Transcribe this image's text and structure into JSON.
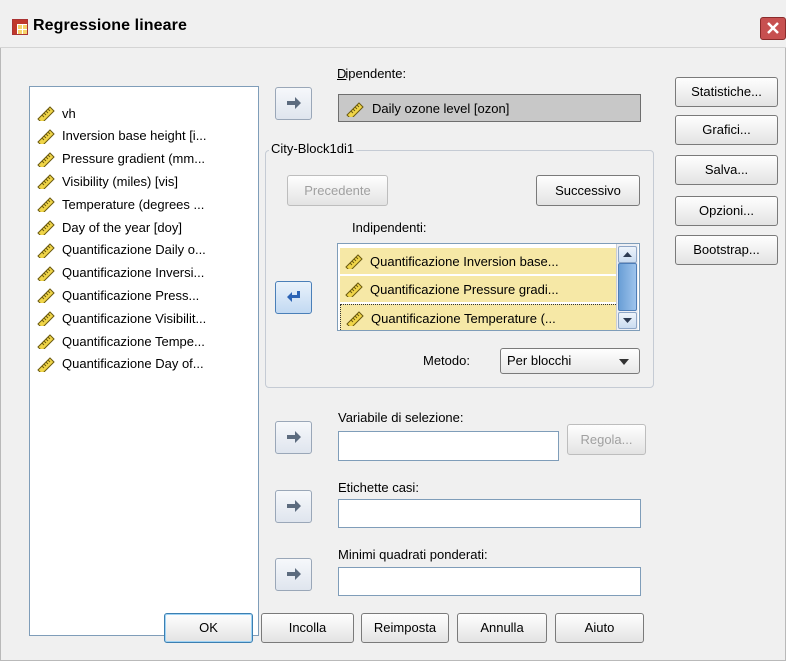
{
  "window": {
    "title": "Regressione lineare",
    "close_label": "✕"
  },
  "variables": [
    "vh",
    "Inversion base height [i...",
    "Pressure gradient (mm...",
    "Visibility (miles) [vis]",
    "Temperature (degrees ...",
    "Day of the year [doy]",
    "Quantificazione Daily o...",
    "Quantificazione Inversi...",
    "Quantificazione Press...",
    "Quantificazione Visibilit...",
    "Quantificazione Tempe...",
    "Quantificazione Day of..."
  ],
  "dependent": {
    "label": "Dipendente:",
    "value": "Daily ozone level [ozon]"
  },
  "block": {
    "group_label": "City-Block1di1",
    "prev_label": "Precedente",
    "next_label": "Successivo",
    "independents_label": "Indipendenti:",
    "independents": [
      "Quantificazione Inversion base...",
      "Quantificazione Pressure gradi...",
      "Quantificazione Temperature (..."
    ],
    "method_label": "Metodo:",
    "method_value": "Per blocchi"
  },
  "selection": {
    "label": "Variabile di selezione:",
    "value": "",
    "rule_label": "Regola..."
  },
  "case_labels": {
    "label": "Etichette casi:",
    "value": ""
  },
  "wls": {
    "label": "Minimi quadrati ponderati:",
    "value": ""
  },
  "side_buttons": [
    "Statistiche...",
    "Grafici...",
    "Salva...",
    "Opzioni...",
    "Bootstrap..."
  ],
  "bottom_buttons": [
    "OK",
    "Incolla",
    "Reimposta",
    "Annulla",
    "Aiuto"
  ],
  "colors": {
    "selected_item_bg": "#f6e8a6",
    "accent_arrow": "#2b63b5"
  }
}
